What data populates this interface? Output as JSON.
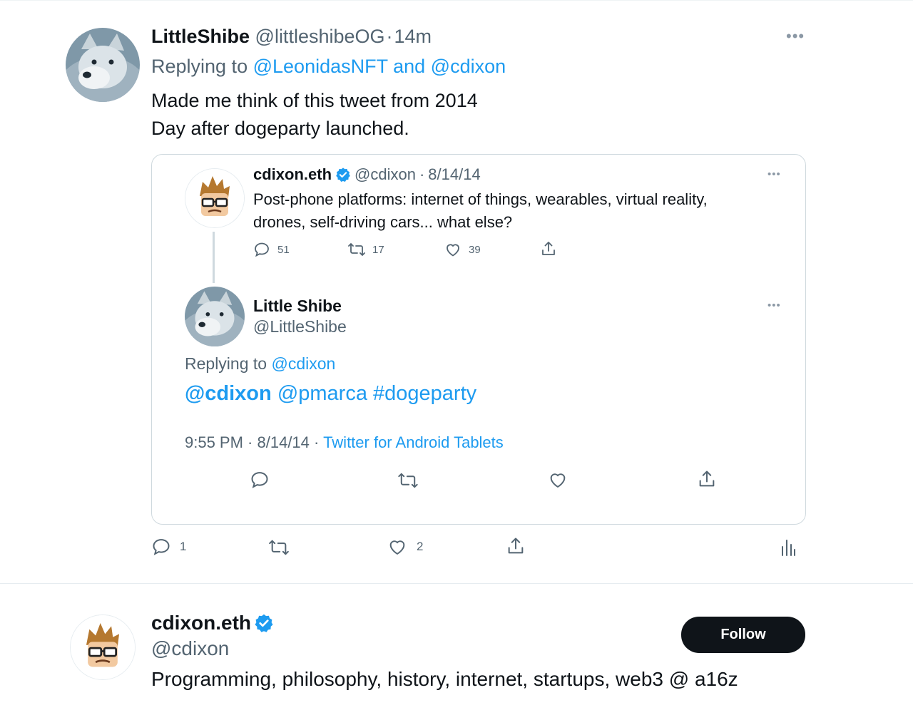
{
  "tweet": {
    "display_name": "LittleShibe",
    "handle": "@littleshibeOG",
    "sep": "·",
    "time": "14m",
    "replying_prefix": "Replying to",
    "replying_to": "@LeonidasNFT and @cdixon",
    "text_line1": "Made me think of this tweet from 2014",
    "text_line2": "Day after dogeparty launched.",
    "actions": {
      "reply_count": "1",
      "like_count": "2"
    }
  },
  "quoted": {
    "parent": {
      "display_name": "cdixon.eth",
      "handle": "@cdixon",
      "sep": "·",
      "date": "8/14/14",
      "text_line1": "Post-phone platforms: internet of things, wearables, virtual reality,",
      "text_line2": "drones, self-driving cars... what else?",
      "reply_count": "51",
      "retweet_count": "17",
      "like_count": "39"
    },
    "reply": {
      "display_name": "Little Shibe",
      "handle": "@LittleShibe",
      "replying_prefix": "Replying to",
      "replying_to": "@cdixon",
      "mention_bold": "@cdixon",
      "mention2": "@pmarca",
      "hashtag": "#dogeparty",
      "time": "9:55 PM",
      "date": "8/14/14",
      "source": "Twitter for Android Tablets"
    }
  },
  "profile": {
    "display_name": "cdixon.eth",
    "handle": "@cdixon",
    "bio": "Programming, philosophy, history, internet, startups, web3 @ a16z",
    "follow_label": "Follow"
  },
  "colors": {
    "accent": "#1d9bf0",
    "text": "#0f1419",
    "secondary": "#536471",
    "border": "#cfd9de"
  }
}
